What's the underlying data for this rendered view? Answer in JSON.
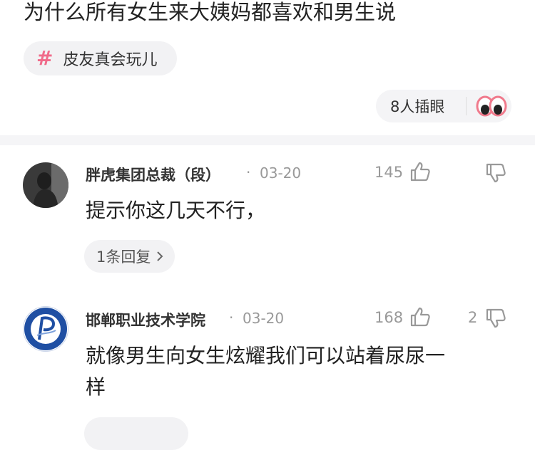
{
  "post": {
    "title": "为什么所有女生来大姨妈都喜欢和男生说",
    "topic": "皮友真会玩儿",
    "peek_label": "8人插眼"
  },
  "comments": [
    {
      "author": "胖虎集团总裁（段）",
      "date": "03-20",
      "likes": "145",
      "dislikes": "",
      "text": "提示你这几天不行，",
      "replies_label": "1条回复"
    },
    {
      "author": "邯郸职业技术学院",
      "date": "03-20",
      "likes": "168",
      "dislikes": "2",
      "text": [
        "就像男生向女生炫耀我们可以站着尿尿一",
        "样"
      ]
    }
  ],
  "colors": {
    "accent_hash": "#f06b8a",
    "muted": "#999999",
    "logo_blue": "#1f4fa3"
  },
  "icons": [
    "hash-icon",
    "eyes-icon",
    "thumb-up-icon",
    "thumb-down-icon",
    "chevron-right-icon",
    "avatar-photo",
    "school-logo"
  ]
}
